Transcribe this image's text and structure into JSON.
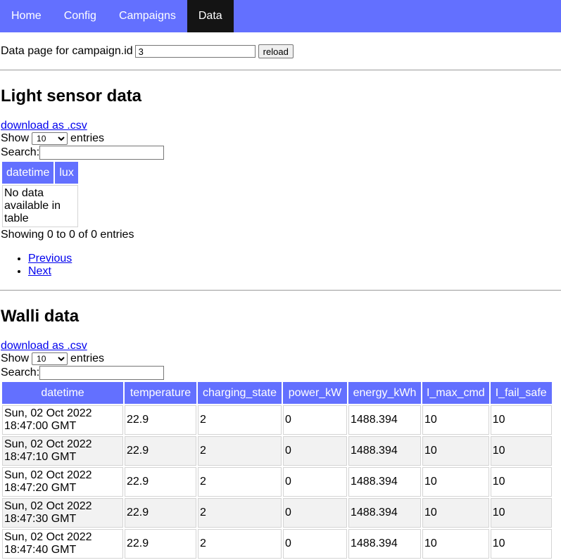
{
  "nav": {
    "items": [
      {
        "label": "Home"
      },
      {
        "label": "Config"
      },
      {
        "label": "Campaigns"
      },
      {
        "label": "Data"
      }
    ]
  },
  "campaign": {
    "label": "Data page for campaign.id",
    "value": "3",
    "reload_label": "reload"
  },
  "light": {
    "title": "Light sensor data",
    "download": "download as .csv",
    "show_label": "Show",
    "show_value": "10",
    "entries_label": "entries",
    "search_label": "Search:",
    "columns": [
      "datetime",
      "lux"
    ],
    "empty_line1": "No data",
    "empty_line2": "available in",
    "empty_line3": "table",
    "info": "Showing 0 to 0 of 0 entries",
    "prev": "Previous",
    "next": "Next"
  },
  "walli": {
    "title": "Walli data",
    "download": "download as .csv",
    "show_label": "Show",
    "show_value": "10",
    "entries_label": "entries",
    "search_label": "Search:",
    "columns": [
      "datetime",
      "temperature",
      "charging_state",
      "power_kW",
      "energy_kWh",
      "I_max_cmd",
      "I_fail_safe"
    ],
    "rows": [
      {
        "date": "Sun, 02 Oct 2022",
        "time": "18:47:00 GMT",
        "temperature": "22.9",
        "charging_state": "2",
        "power_kW": "0",
        "energy_kWh": "1488.394",
        "I_max_cmd": "10",
        "I_fail_safe": "10"
      },
      {
        "date": "Sun, 02 Oct 2022",
        "time": "18:47:10 GMT",
        "temperature": "22.9",
        "charging_state": "2",
        "power_kW": "0",
        "energy_kWh": "1488.394",
        "I_max_cmd": "10",
        "I_fail_safe": "10"
      },
      {
        "date": "Sun, 02 Oct 2022",
        "time": "18:47:20 GMT",
        "temperature": "22.9",
        "charging_state": "2",
        "power_kW": "0",
        "energy_kWh": "1488.394",
        "I_max_cmd": "10",
        "I_fail_safe": "10"
      },
      {
        "date": "Sun, 02 Oct 2022",
        "time": "18:47:30 GMT",
        "temperature": "22.9",
        "charging_state": "2",
        "power_kW": "0",
        "energy_kWh": "1488.394",
        "I_max_cmd": "10",
        "I_fail_safe": "10"
      },
      {
        "date": "Sun, 02 Oct 2022",
        "time": "18:47:40 GMT",
        "temperature": "22.9",
        "charging_state": "2",
        "power_kW": "0",
        "energy_kWh": "1488.394",
        "I_max_cmd": "10",
        "I_fail_safe": "10"
      }
    ]
  }
}
